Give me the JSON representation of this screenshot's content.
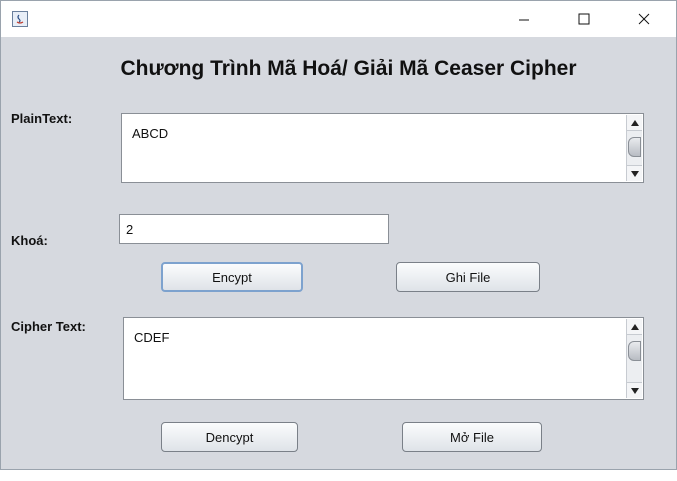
{
  "window": {
    "minimize_symbol": "—",
    "maximize_symbol": "☐",
    "close_symbol": "✕"
  },
  "app": {
    "title": "Chương Trình Mã Hoá/ Giải Mã Ceaser Cipher"
  },
  "plaintext": {
    "label": "PlainText:",
    "value": "ABCD"
  },
  "key": {
    "label": "Khoá:",
    "value": "2"
  },
  "buttons": {
    "encrypt": "Encypt",
    "save_file": "Ghi File",
    "decrypt": "Dencypt",
    "open_file": "Mở File"
  },
  "ciphertext": {
    "label": "Cipher Text:",
    "value": "CDEF"
  }
}
